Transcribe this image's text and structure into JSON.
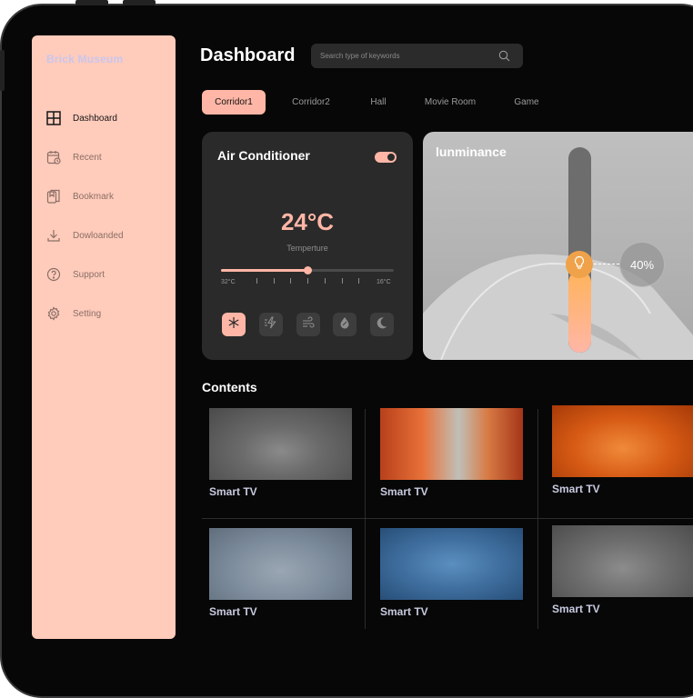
{
  "brand": "Brick Museum",
  "page_title": "Dashboard",
  "search": {
    "placeholder": "Search type of keywords",
    "icon": "search-icon"
  },
  "sidebar": {
    "items": [
      {
        "label": "Dashboard",
        "icon": "grid-icon",
        "active": true
      },
      {
        "label": "Recent",
        "icon": "calendar-clock-icon",
        "active": false
      },
      {
        "label": "Bookmark",
        "icon": "bookmark-icon",
        "active": false
      },
      {
        "label": "Dowloanded",
        "icon": "download-icon",
        "active": false
      },
      {
        "label": "Support",
        "icon": "help-icon",
        "active": false
      },
      {
        "label": "Setting",
        "icon": "gear-icon",
        "active": false
      }
    ]
  },
  "tabs": [
    {
      "label": "Corridor1",
      "active": true
    },
    {
      "label": "Corridor2",
      "active": false
    },
    {
      "label": "Hall",
      "active": false
    },
    {
      "label": "Movie Room",
      "active": false
    },
    {
      "label": "Game",
      "active": false
    }
  ],
  "air_conditioner": {
    "title": "Air Conditioner",
    "power_on": true,
    "temperature": "24°C",
    "temperature_label": "Temperture",
    "scale_min": "32°C",
    "scale_max": "16°C",
    "slider_level": 0.5,
    "modes": [
      {
        "icon": "snowflake-icon",
        "active": true
      },
      {
        "icon": "lightning-icon",
        "active": false
      },
      {
        "icon": "wind-icon",
        "active": false
      },
      {
        "icon": "droplet-icon",
        "active": false
      },
      {
        "icon": "moon-icon",
        "active": false
      }
    ]
  },
  "luminance": {
    "title": "lunminance",
    "value": "40%",
    "level": 0.4,
    "icon": "lightbulb-icon"
  },
  "contents": {
    "title": "Contents",
    "items": [
      {
        "label": "Smart TV"
      },
      {
        "label": "Smart TV"
      },
      {
        "label": "Smart TV"
      },
      {
        "label": "Smart TV"
      },
      {
        "label": "Smart TV"
      },
      {
        "label": "Smart TV"
      }
    ]
  },
  "colors": {
    "accent": "#ffb6a6",
    "sidebar_bg": "#ffcbbb",
    "card_bg": "#2a2a2a",
    "screen_bg": "#070707"
  }
}
